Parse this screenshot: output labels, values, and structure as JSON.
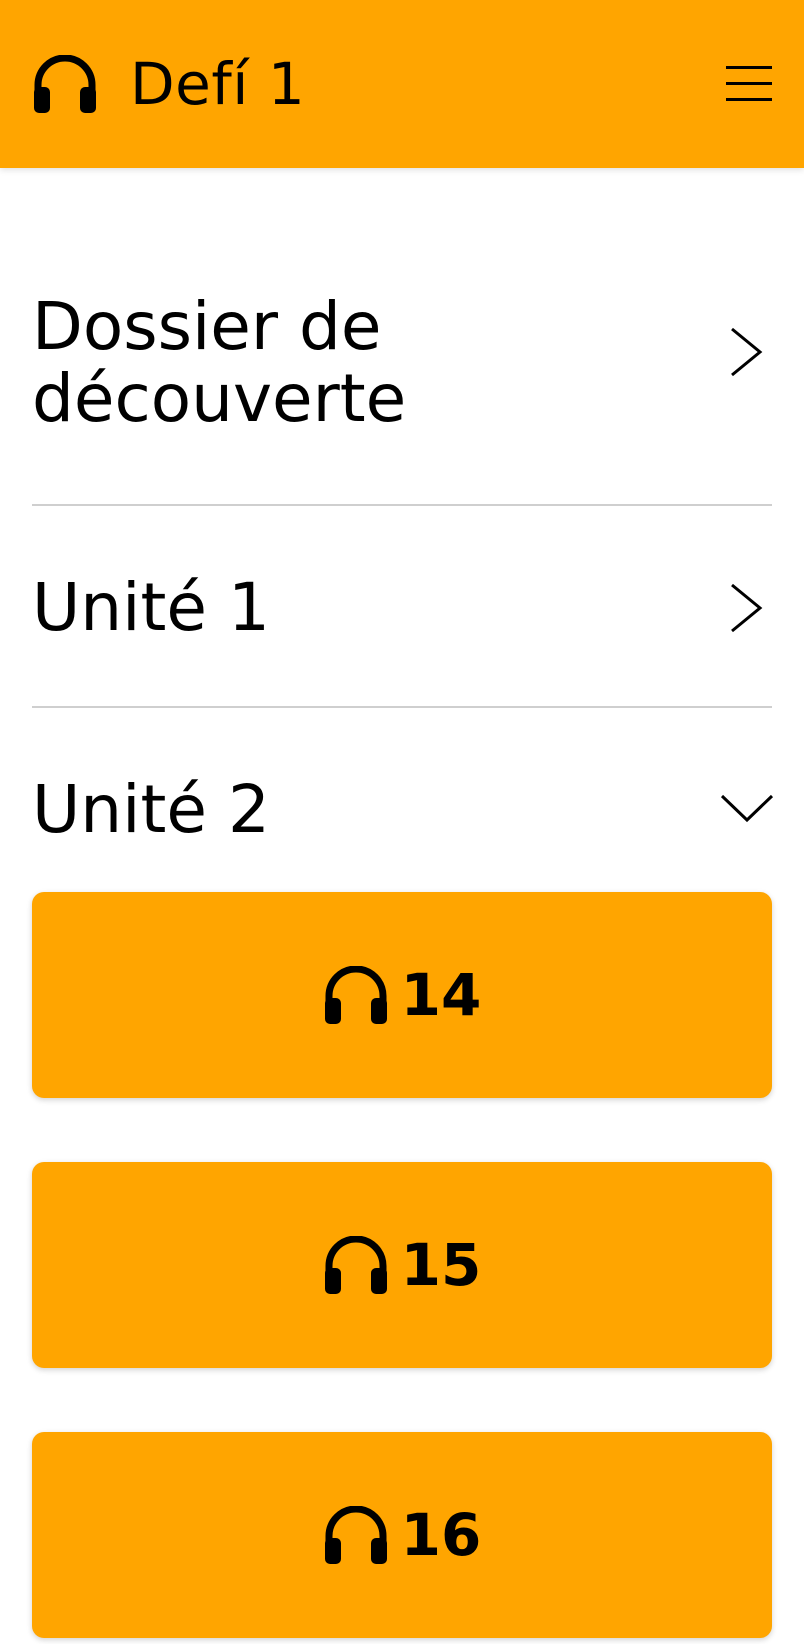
{
  "header": {
    "title": "Defí 1",
    "icon": "headphones-icon",
    "background_color": "#FFA500"
  },
  "sections": [
    {
      "label_lines": [
        "Dossier de",
        "découverte"
      ],
      "state": "collapsed",
      "chevron": "chevron-right-icon"
    },
    {
      "label": "Unité 1",
      "state": "collapsed",
      "chevron": "chevron-right-icon"
    },
    {
      "label": "Unité 2",
      "state": "expanded",
      "chevron": "chevron-down-icon"
    }
  ],
  "tracks": [
    {
      "number": "14",
      "icon": "headphones-icon"
    },
    {
      "number": "15",
      "icon": "headphones-icon"
    },
    {
      "number": "16",
      "icon": "headphones-icon"
    }
  ],
  "colors": {
    "accent": "#FFA500",
    "divider": "#cfcfcf"
  }
}
